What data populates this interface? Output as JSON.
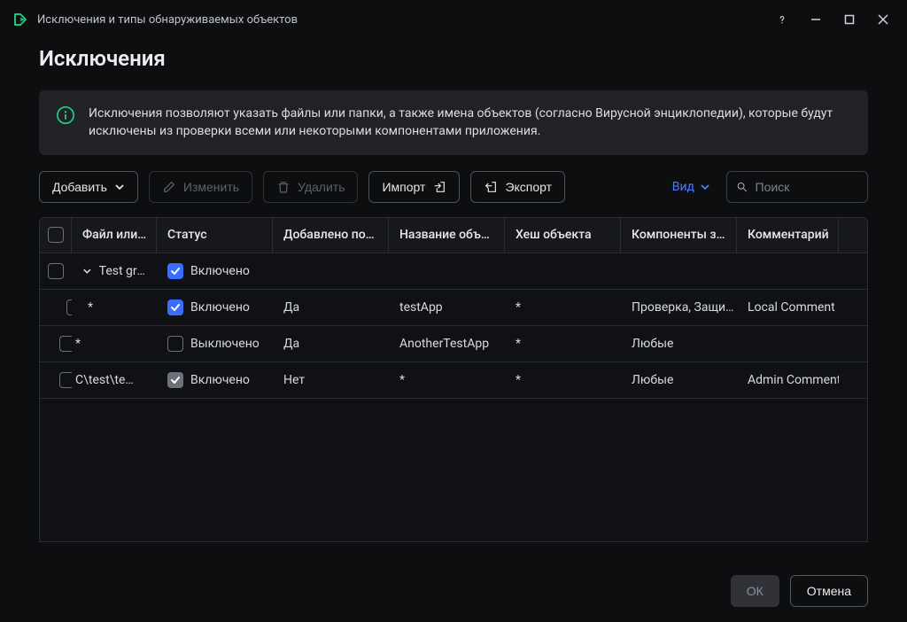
{
  "titlebar": {
    "title": "Исключения и типы обнаруживаемых объектов"
  },
  "page": {
    "heading": "Исключения"
  },
  "info": {
    "text": "Исключения позволяют указать файлы или папки, а также имена объектов (согласно Вирусной энциклопедии), которые будут исключены из проверки всеми или некоторыми компонентами приложения."
  },
  "toolbar": {
    "add": "Добавить",
    "edit": "Изменить",
    "delete": "Удалить",
    "import": "Импорт",
    "export": "Экспорт",
    "view": "Вид",
    "search_placeholder": "Поиск"
  },
  "columns": {
    "file": "Файл или…",
    "status": "Статус",
    "added": "Добавлено по…",
    "objname": "Название объ…",
    "hash": "Хеш объекта",
    "components": "Компоненты з…",
    "comment": "Комментарий"
  },
  "group": {
    "label": "Test gro…",
    "status": "Включено",
    "status_checked": true
  },
  "rows": [
    {
      "file": "*",
      "status": "Включено",
      "status_checked": true,
      "status_gray": false,
      "added": "Да",
      "objname": "testApp",
      "hash": "*",
      "components": "Проверка, Защи…",
      "comment": "Local Comment",
      "indent": true
    },
    {
      "file": "*",
      "status": "Выключено",
      "status_checked": false,
      "status_gray": false,
      "added": "Да",
      "objname": "AnotherTestApp",
      "hash": "*",
      "components": "Любые",
      "comment": "",
      "indent": false
    },
    {
      "file": "C\\test\\te…",
      "status": "Включено",
      "status_checked": true,
      "status_gray": true,
      "added": "Нет",
      "objname": "*",
      "hash": "*",
      "components": "Любые",
      "comment": "Admin Comment",
      "indent": false
    }
  ],
  "footer": {
    "ok": "ОК",
    "cancel": "Отмена"
  }
}
